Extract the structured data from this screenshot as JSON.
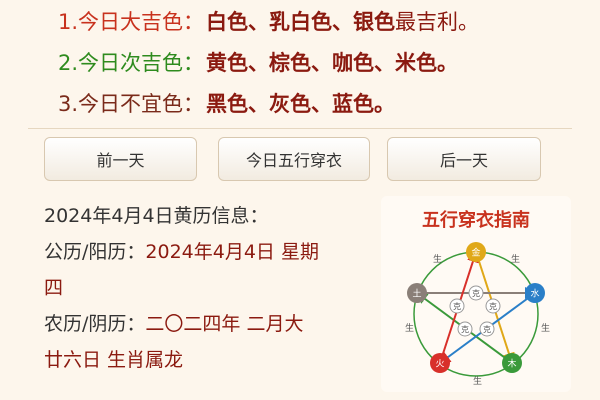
{
  "colors": [
    {
      "label": "1.今日大吉色：",
      "value": "白色、乳白色、银色",
      "tail": "最吉利。"
    },
    {
      "label": "2.今日次吉色：",
      "value": "黄色、棕色、咖色、米色。",
      "tail": ""
    },
    {
      "label": "3.今日不宜色：",
      "value": "黑色、灰色、蓝色。",
      "tail": ""
    }
  ],
  "buttons": {
    "prev": "前一天",
    "today": "今日五行穿衣",
    "next": "后一天"
  },
  "info": {
    "header": "2024年4月4日黄历信息：",
    "solar_label": "公历/阳历：",
    "solar_value": "2024年4月4日 星期",
    "solar_value2": "四",
    "lunar_label": "农历/阴历：",
    "lunar_value": "二〇二四年 二月大",
    "lunar_value2": "廿六日 生肖属龙"
  },
  "guide": {
    "title": "五行穿衣指南",
    "nodes": {
      "metal": "金",
      "water": "水",
      "wood": "木",
      "fire": "火",
      "earth": "土"
    },
    "gen": "生",
    "ke": "克",
    "colors": {
      "metal": "#e0a818",
      "water": "#2a7fc8",
      "wood": "#3a9a3a",
      "fire": "#d8302a",
      "earth": "#8a7f78"
    }
  }
}
